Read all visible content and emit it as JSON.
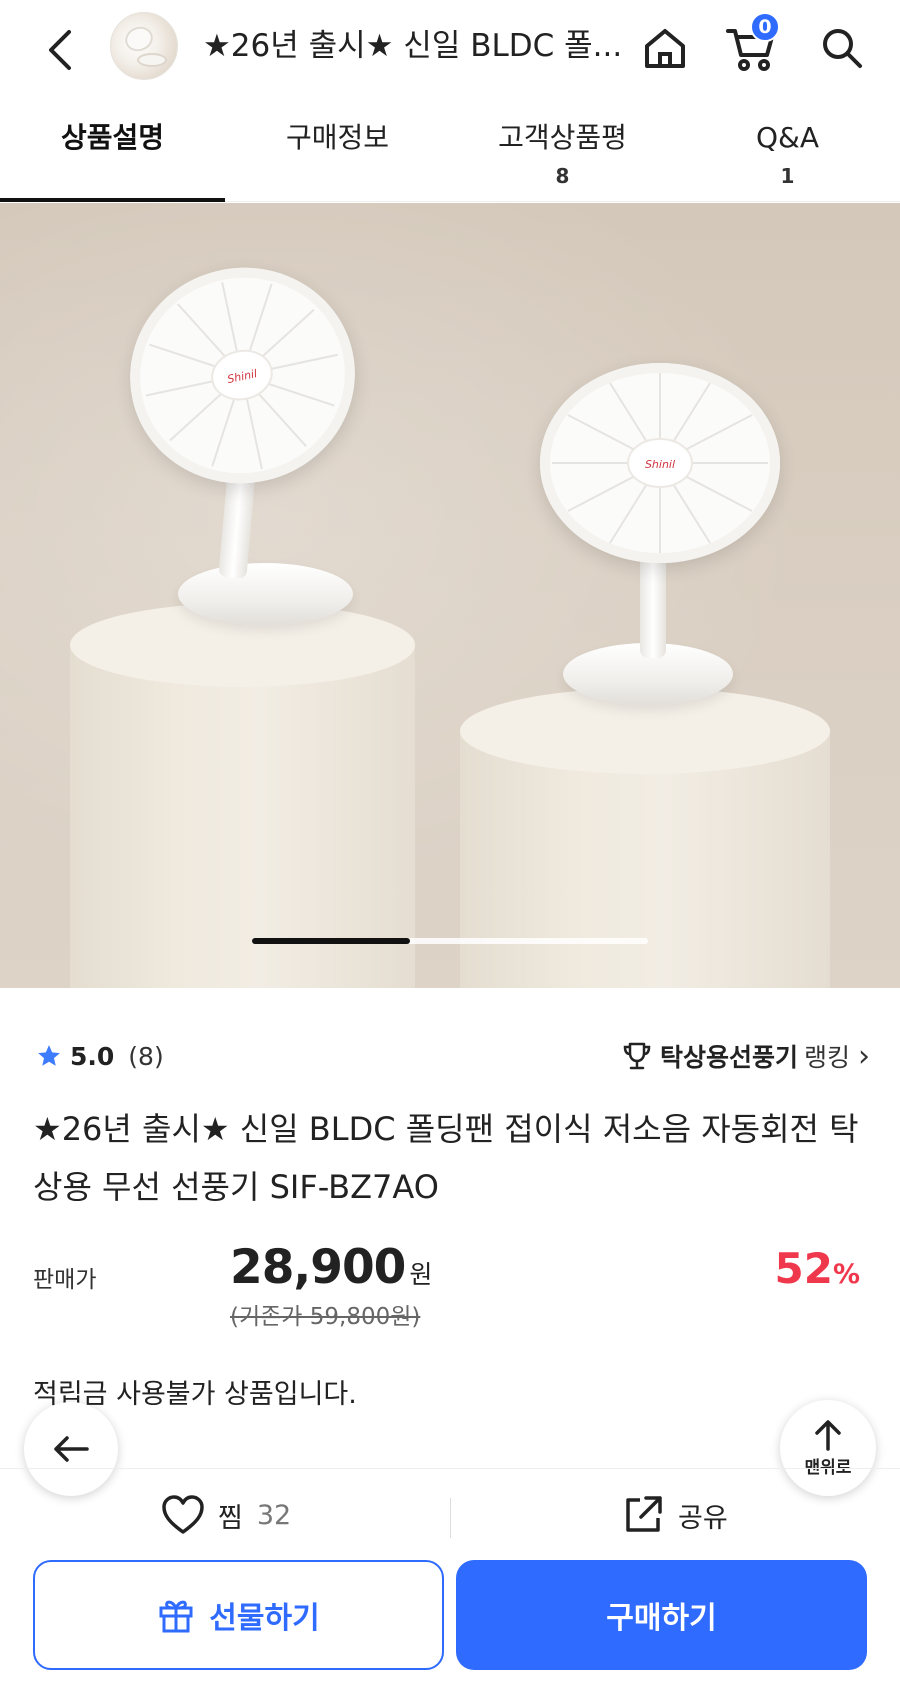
{
  "header": {
    "title": "★26년 출시★ 신일 BLDC 폴...",
    "cart_count": "0"
  },
  "tabs": [
    {
      "label": "상품설명",
      "count": "",
      "active": true
    },
    {
      "label": "구매정보",
      "count": "",
      "active": false
    },
    {
      "label": "고객상품평",
      "count": "8",
      "active": false
    },
    {
      "label": "Q&A",
      "count": "1",
      "active": false
    }
  ],
  "hero": {
    "fan_logo": "Shinil",
    "carousel_progress": 0.4
  },
  "rating": {
    "score": "5.0",
    "count": "(8)"
  },
  "ranking": {
    "category": "탁상용선풍기",
    "suffix": "랭킹",
    "chevron": "›"
  },
  "product": {
    "title": "★26년 출시★ 신일 BLDC 폴딩팬 접이식 저소음 자동회전 탁상용 무선 선풍기 SIF-BZ7AO"
  },
  "price": {
    "label": "판매가",
    "current": "28,900",
    "unit": "원",
    "original": "(기존가 59,800원)",
    "discount_number": "52",
    "discount_symbol": "%"
  },
  "notice": {
    "points": "적립금 사용불가 상품입니다."
  },
  "float": {
    "top_label": "맨위로"
  },
  "actions": {
    "wish_label": "찜",
    "wish_count": "32",
    "share_label": "공유"
  },
  "buttons": {
    "gift": "선물하기",
    "buy": "구매하기"
  },
  "colors": {
    "accent": "#2f6bff",
    "discount": "#f0384d",
    "star": "#3d7bff"
  },
  "icons": [
    "back-icon",
    "home-icon",
    "cart-icon",
    "search-icon",
    "star-icon",
    "trophy-icon",
    "chevron-right-icon",
    "arrow-left-icon",
    "arrow-up-icon",
    "heart-icon",
    "share-icon",
    "gift-icon"
  ]
}
